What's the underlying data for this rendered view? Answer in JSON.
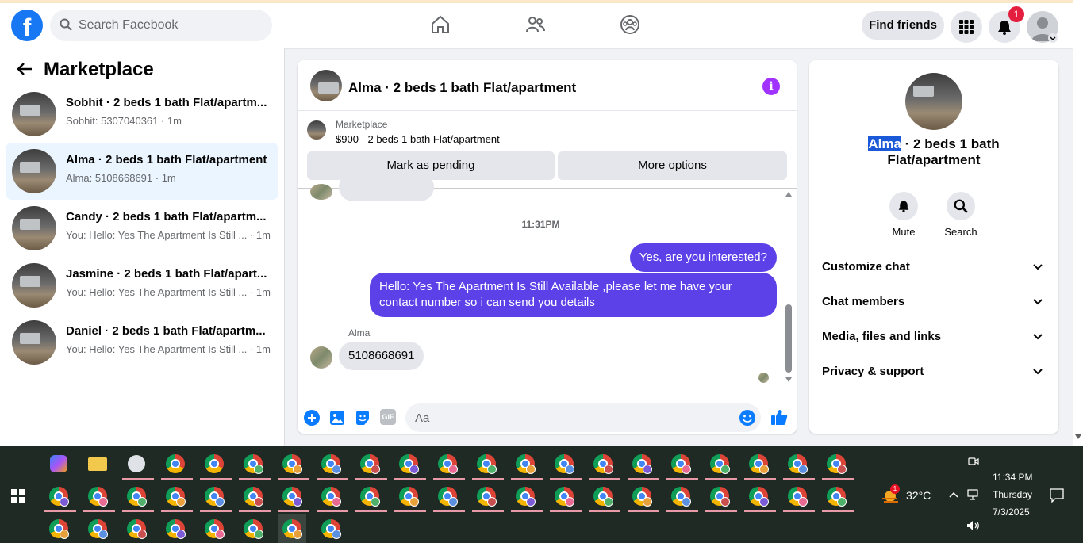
{
  "topbar": {
    "logo": "f",
    "search_placeholder": "Search Facebook",
    "find_friends": "Find friends",
    "notif_count": "1"
  },
  "sidebar": {
    "title": "Marketplace",
    "items": [
      {
        "name": "Sobhit · 2 beds 1 bath Flat/apartm...",
        "sub": "Sobhit: 5307040361 · 1m"
      },
      {
        "name": "Alma · 2 beds 1 bath Flat/apartment",
        "sub": "Alma: 5108668691 · 1m"
      },
      {
        "name": "Candy · 2 beds 1 bath Flat/apartm...",
        "sub": "You: Hello: Yes The Apartment Is Still ... · 1m"
      },
      {
        "name": "Jasmine · 2 beds 1 bath Flat/apart...",
        "sub": "You: Hello: Yes The Apartment Is Still ... · 1m"
      },
      {
        "name": "Daniel · 2 beds 1 bath Flat/apartm...",
        "sub": "You: Hello: Yes The Apartment Is Still ... · 1m"
      }
    ]
  },
  "conversation": {
    "title": "Alma · 2 beds 1 bath Flat/apartment",
    "info": "i",
    "marketplace_label": "Marketplace",
    "listing": "$900 - 2 beds 1 bath Flat/apartment",
    "mark_pending": "Mark as pending",
    "more_options": "More options",
    "timestamp": "11:31PM",
    "messages": {
      "out1": "Yes, are you interested?",
      "out2": "Hello: Yes The Apartment Is Still Available ,please let me have your contact number so i can send you details",
      "sender": "Alma",
      "in1": "5108668691"
    },
    "composer_placeholder": "Aa",
    "gif_label": "GIF"
  },
  "right_panel": {
    "name_highlight": "Alma",
    "title_rest": " · 2 beds 1 bath Flat/apartment",
    "mute": "Mute",
    "search": "Search",
    "rows": [
      "Customize chat",
      "Chat members",
      "Media, files and links",
      "Privacy & support"
    ]
  },
  "taskbar": {
    "temperature": "32°C",
    "weather_badge": "1",
    "time": "11:34 PM",
    "day": "Thursday",
    "date": "7/3/2025"
  },
  "colors": {
    "brand": "#1877f2",
    "bubble_out": "#5c41e8",
    "info": "#a033ff",
    "taskbar": "#1f2a24"
  }
}
